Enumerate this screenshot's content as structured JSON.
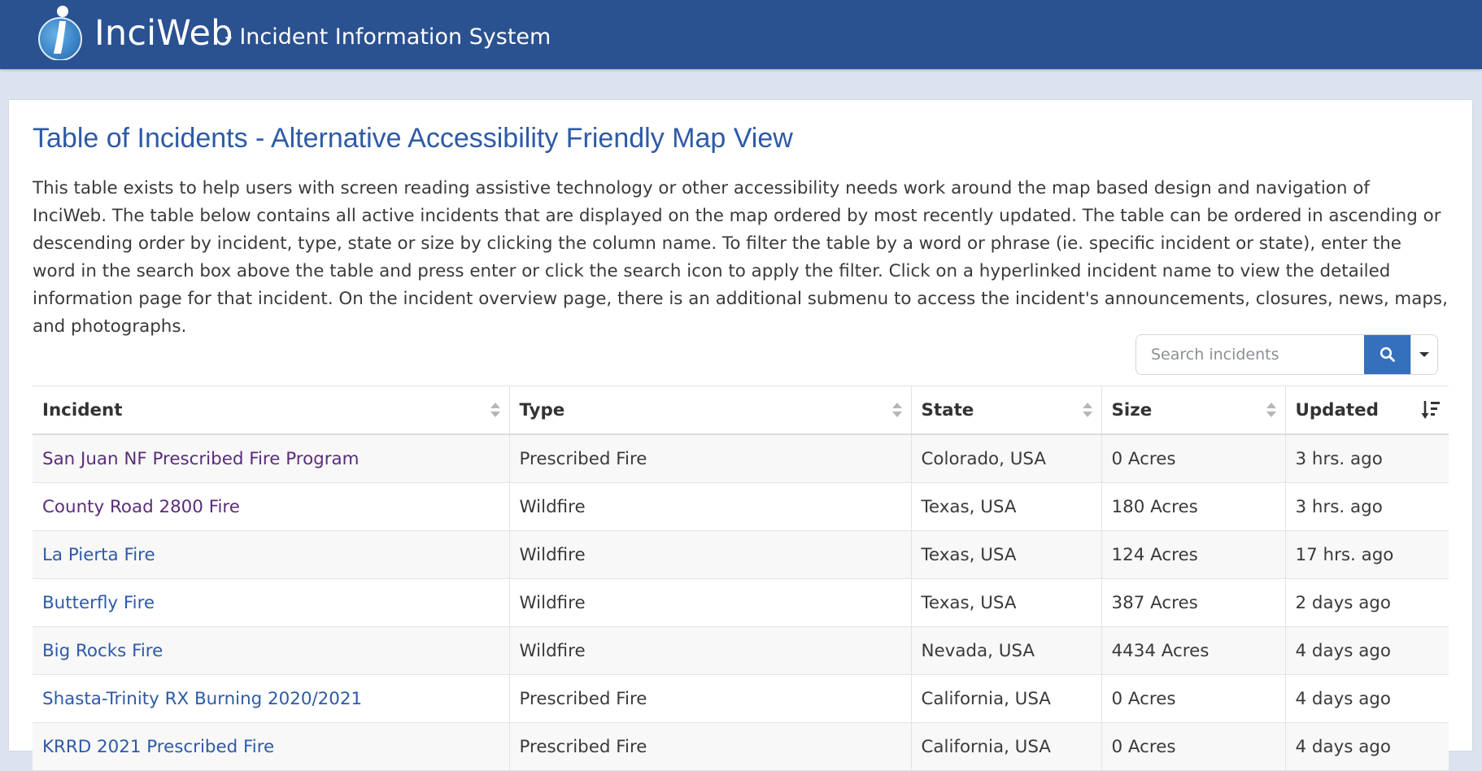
{
  "header": {
    "brand": "InciWeb",
    "subtitle": "- Incident Information System",
    "colors": {
      "bar": "#2a5190",
      "logo": "#3a86c8"
    }
  },
  "main": {
    "title": "Table of Incidents - Alternative Accessibility Friendly Map View",
    "intro": "This table exists to help users with screen reading assistive technology or other accessibility needs work around the map based design and navigation of InciWeb. The table below contains all active incidents that are displayed on the map ordered by most recently updated. The table can be ordered in ascending or descending order by incident, type, state or size by clicking the column name. To filter the table by a word or phrase (ie. specific incident or state), enter the word in the search box above the table and press enter or click the search icon to apply the filter. Click on a hyperlinked incident name to view the detailed information page for that incident. On the incident overview page, there is an additional submenu to access the incident's announcements, closures, news, maps, and photographs."
  },
  "search": {
    "placeholder": "Search incidents",
    "button_icon": "search-icon",
    "dropdown_icon": "caret-down-icon"
  },
  "table": {
    "columns": [
      "Incident",
      "Type",
      "State",
      "Size",
      "Updated"
    ],
    "sorted_column": "Updated",
    "sort_direction": "descending",
    "rows": [
      {
        "incident": "San Juan NF Prescribed Fire Program",
        "type": "Prescribed Fire",
        "state": "Colorado, USA",
        "size": "0 Acres",
        "updated": "3 hrs. ago",
        "visited": true
      },
      {
        "incident": "County Road 2800 Fire",
        "type": "Wildfire",
        "state": "Texas, USA",
        "size": "180 Acres",
        "updated": "3 hrs. ago",
        "visited": true
      },
      {
        "incident": "La Pierta Fire",
        "type": "Wildfire",
        "state": "Texas, USA",
        "size": "124 Acres",
        "updated": "17 hrs. ago",
        "visited": false
      },
      {
        "incident": "Butterfly Fire",
        "type": "Wildfire",
        "state": "Texas, USA",
        "size": "387 Acres",
        "updated": "2 days ago",
        "visited": false
      },
      {
        "incident": "Big Rocks Fire",
        "type": "Wildfire",
        "state": "Nevada, USA",
        "size": "4434 Acres",
        "updated": "4 days ago",
        "visited": false
      },
      {
        "incident": "Shasta-Trinity RX Burning 2020/2021",
        "type": "Prescribed Fire",
        "state": "California, USA",
        "size": "0 Acres",
        "updated": "4 days ago",
        "visited": false
      },
      {
        "incident": "KRRD 2021 Prescribed Fire",
        "type": "Prescribed Fire",
        "state": "California, USA",
        "size": "0 Acres",
        "updated": "4 days ago",
        "visited": false
      }
    ]
  }
}
